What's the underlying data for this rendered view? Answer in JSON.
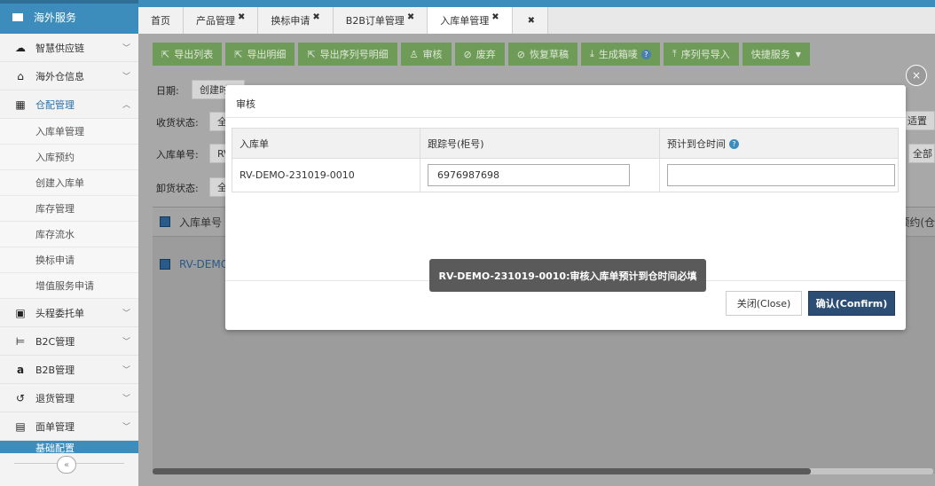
{
  "sidebar": {
    "header": "海外服务",
    "items": [
      {
        "label": "智慧供应链",
        "icon": "cloud-icon"
      },
      {
        "label": "海外仓信息",
        "icon": "home-icon"
      },
      {
        "label": "仓配管理",
        "icon": "grid-icon"
      }
    ],
    "sub_items": [
      "入库单管理",
      "入库预约",
      "创建入库单",
      "库存管理",
      "库存流水",
      "换标申请",
      "增值服务申请"
    ],
    "items2": [
      {
        "label": "头程委托单",
        "icon": "briefcase-icon"
      },
      {
        "label": "B2C管理",
        "icon": "cart-icon"
      },
      {
        "label": "B2B管理",
        "icon": "amazon-icon"
      },
      {
        "label": "退货管理",
        "icon": "undo-icon"
      },
      {
        "label": "面单管理",
        "icon": "file-icon"
      }
    ],
    "footer": "基础配置",
    "collapse_glyph": "«"
  },
  "tabs": [
    {
      "label": "首页",
      "close": ""
    },
    {
      "label": "产品管理",
      "close": "✖"
    },
    {
      "label": "换标申请",
      "close": "✖"
    },
    {
      "label": "B2B订单管理",
      "close": "✖"
    },
    {
      "label": "入库单管理",
      "close": "✖"
    },
    {
      "label": "",
      "close": "✖"
    }
  ],
  "toolbar": {
    "buttons": [
      "导出列表",
      "导出明细",
      "导出序列号明细",
      "审核",
      "废弃",
      "恢复草稿",
      "生成箱唛",
      "序列号导入",
      "快捷服务"
    ]
  },
  "filters": {
    "date_label": "日期:",
    "date_value": "创建时",
    "receive_label": "收货状态:",
    "receive_value": "全",
    "inbound_label": "入库单号:",
    "inbound_value": "RV",
    "unload_label": "卸货状态:",
    "unload_value": "全",
    "right_top": "适置",
    "right_all": "全部"
  },
  "grid": {
    "header_label": "入库单号",
    "right_header": "预约(仓",
    "row_link": "RV-DEMO-"
  },
  "modal": {
    "title": "审核",
    "columns": [
      "入库单",
      "跟踪号(柜号)",
      "预计到仓时间"
    ],
    "row": {
      "inbound": "RV-DEMO-231019-0010",
      "tracking": "6976987698",
      "eta": ""
    },
    "help_glyph": "?",
    "close_label": "关闭(Close)",
    "confirm_label": "确认(Confirm)"
  },
  "toast": "RV-DEMO-231019-0010:审核入库单预计到仓时间必填",
  "modal_close_glyph": "×"
}
